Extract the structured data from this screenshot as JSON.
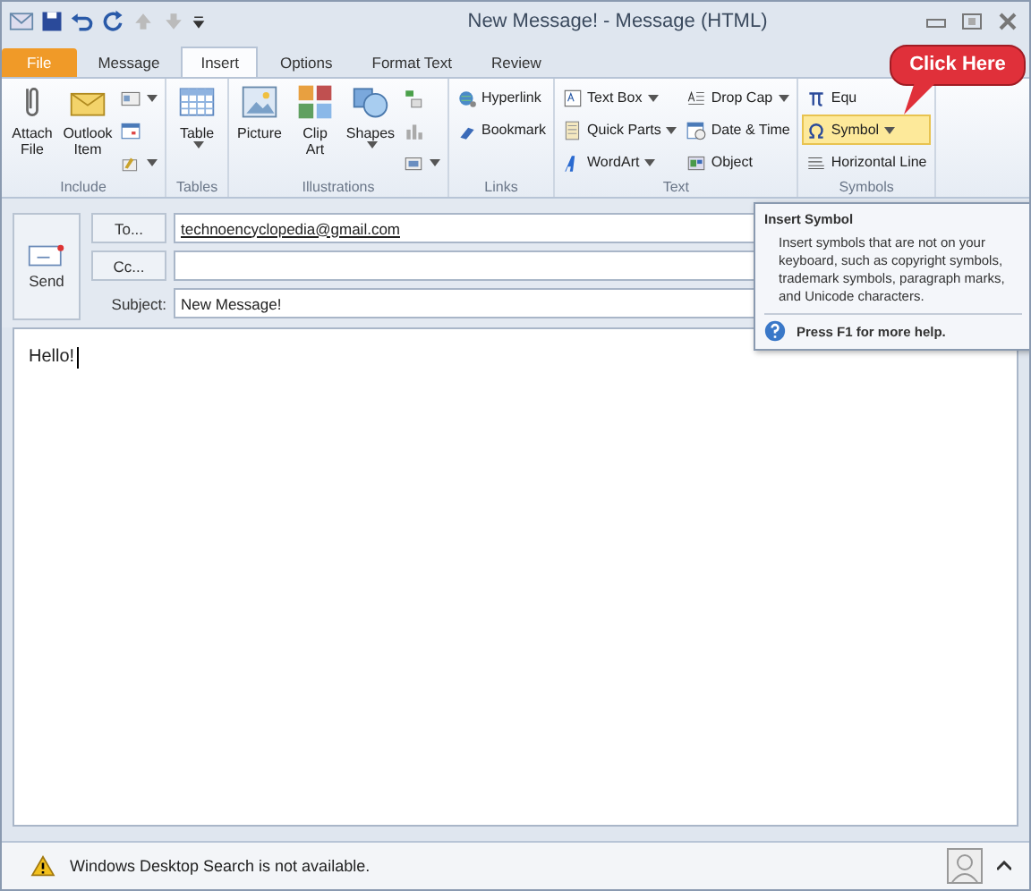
{
  "window": {
    "title": "New Message! - Message (HTML)"
  },
  "tabs": [
    {
      "label": "File",
      "kind": "file",
      "selected": false
    },
    {
      "label": "Message",
      "kind": "tab",
      "selected": false
    },
    {
      "label": "Insert",
      "kind": "tab",
      "selected": true
    },
    {
      "label": "Options",
      "kind": "tab",
      "selected": false
    },
    {
      "label": "Format Text",
      "kind": "tab",
      "selected": false
    },
    {
      "label": "Review",
      "kind": "tab",
      "selected": false
    }
  ],
  "ribbon_groups": [
    {
      "label": "Include",
      "items": [
        {
          "label": "Attach File",
          "kind": "large",
          "menu": false
        },
        {
          "label": "Outlook Item",
          "kind": "large",
          "menu": false
        },
        {
          "kind": "icon",
          "menu": true
        },
        {
          "kind": "icon",
          "menu": false
        },
        {
          "kind": "icon",
          "menu": true
        }
      ]
    },
    {
      "label": "Tables",
      "items": [
        {
          "label": "Table",
          "kind": "large",
          "menu": true
        }
      ]
    },
    {
      "label": "Illustrations",
      "items": [
        {
          "label": "Picture",
          "kind": "large",
          "menu": false
        },
        {
          "label": "Clip Art",
          "kind": "large",
          "menu": false
        },
        {
          "label": "Shapes",
          "kind": "large",
          "menu": true
        },
        {
          "kind": "icon",
          "menu": false
        },
        {
          "kind": "icon",
          "menu": false
        },
        {
          "kind": "icon",
          "menu": true
        }
      ]
    },
    {
      "label": "Links",
      "items": [
        {
          "label": "Hyperlink",
          "kind": "small",
          "menu": false
        },
        {
          "label": "Bookmark",
          "kind": "small",
          "menu": false
        }
      ]
    },
    {
      "label": "Text",
      "items": [
        {
          "label": "Text Box",
          "kind": "small",
          "menu": true
        },
        {
          "label": "Quick Parts",
          "kind": "small",
          "menu": true
        },
        {
          "label": "WordArt",
          "kind": "small",
          "menu": true
        },
        {
          "label": "Drop Cap",
          "kind": "small",
          "menu": true
        },
        {
          "label": "Date & Time",
          "kind": "small",
          "menu": false
        },
        {
          "label": "Object",
          "kind": "small",
          "menu": false
        }
      ]
    },
    {
      "label": "Symbols",
      "items": [
        {
          "label": "Equ",
          "kind": "small",
          "menu": false,
          "selected": false
        },
        {
          "label": "Symbol",
          "kind": "small",
          "menu": true,
          "selected": true
        },
        {
          "label": "Horizontal Line",
          "kind": "small",
          "menu": false,
          "selected": false
        }
      ]
    }
  ],
  "callout": {
    "text": "Click Here"
  },
  "tooltip": {
    "title": "Insert Symbol",
    "body": "Insert symbols that are not on your keyboard, such as copyright symbols, trademark symbols, paragraph marks, and Unicode characters.",
    "help": "Press F1 for more help."
  },
  "send_button": {
    "label": "Send"
  },
  "fields": [
    {
      "label": "To...",
      "kind": "button",
      "value": "technoencyclopedia@gmail.com"
    },
    {
      "label": "Cc...",
      "kind": "button"
    },
    {
      "label": "Subject:",
      "kind": "text",
      "value": "New Message!"
    }
  ],
  "body": {
    "text": "Hello!"
  },
  "status_bar": {
    "text": "Windows Desktop Search is not available."
  }
}
